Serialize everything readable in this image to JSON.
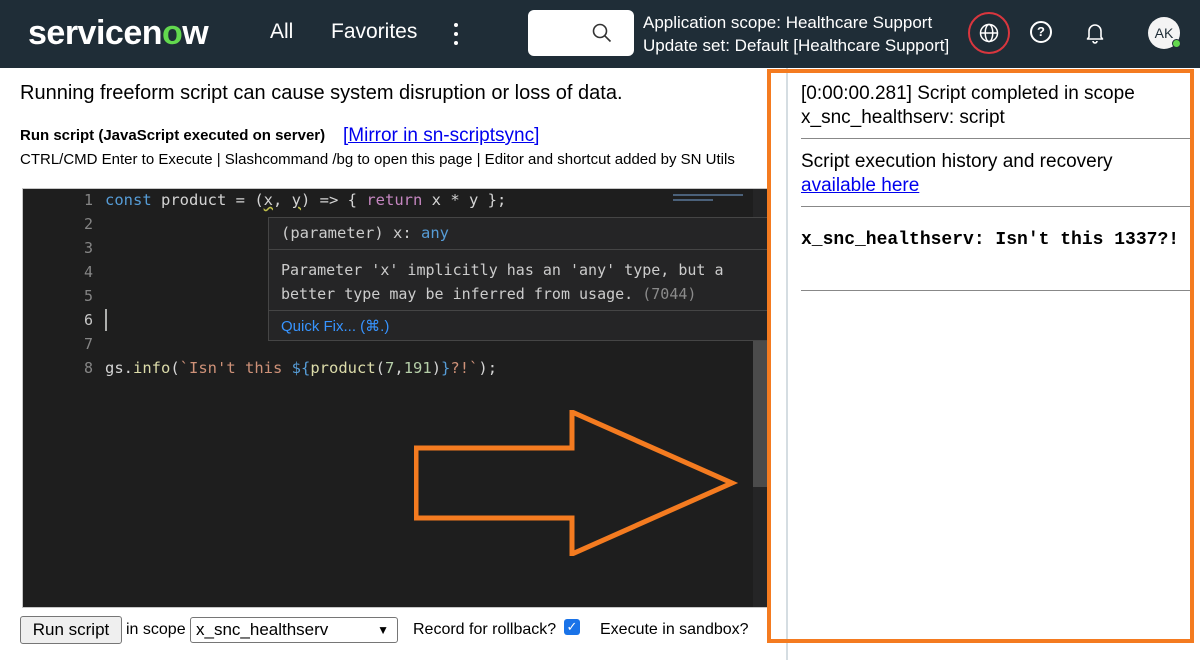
{
  "nav": {
    "logo_service": "servicen",
    "logo_o": "o",
    "logo_w": "w",
    "all": "All",
    "favorites": "Favorites",
    "scope_line1": "Application scope: Healthcare Support",
    "scope_line2": "Update set: Default [Healthcare Support]",
    "help": "?",
    "avatar": "AK"
  },
  "main": {
    "warning": "Running freeform script can cause system disruption or loss of data.",
    "run_title": "Run script (JavaScript executed on server)",
    "mirror_link": "[Mirror in sn-scriptsync]",
    "hint": "CTRL/CMD Enter to Execute | Slashcommand /bg to open this page | Editor and shortcut added by SN Utils"
  },
  "editor": {
    "line_numbers": [
      "1",
      "2",
      "3",
      "4",
      "5",
      "6",
      "7",
      "8"
    ],
    "active_line": 6,
    "line1": {
      "kw": "const",
      "name": " product = (",
      "x": "x",
      "sep": ", ",
      "y": "y",
      "rest": ") => { ",
      "ret": "return",
      "tail": " x * y };"
    },
    "line8": {
      "obj": "gs.",
      "fn": "info",
      "open": "(",
      "str1": "`Isn't this ",
      "interp_open": "${",
      "call": "product",
      "args_open": "(",
      "n1": "7",
      "comma": ",",
      "n2": "191",
      "args_close": ")",
      "interp_close": "}",
      "str2": "?!`",
      "close": ");"
    },
    "tooltip": {
      "sig_prefix": "(parameter) x: ",
      "sig_type": "any",
      "message": "Parameter 'x' implicitly has an 'any' type, but a better type may be inferred from usage.",
      "code": "(7044)",
      "quick_fix": "Quick Fix... (⌘.)"
    }
  },
  "controls": {
    "run_button": "Run script",
    "in_scope": "in scope",
    "scope_value": "x_snc_healthserv",
    "rollback_label": "Record for rollback?",
    "rollback_checked": true,
    "sandbox_label": "Execute in sandbox?"
  },
  "output": {
    "status": "[0:00:00.281] Script completed in scope x_snc_healthserv: script",
    "history_text": "Script execution history and recovery",
    "history_link": "available here",
    "message": "x_snc_healthserv: Isn't this 1337?!"
  },
  "colors": {
    "nav_bg": "#1f2d37",
    "logo_accent": "#62d84e",
    "highlight": "#f47b20",
    "editor_bg": "#1e1e1e",
    "link": "#0000ee"
  }
}
